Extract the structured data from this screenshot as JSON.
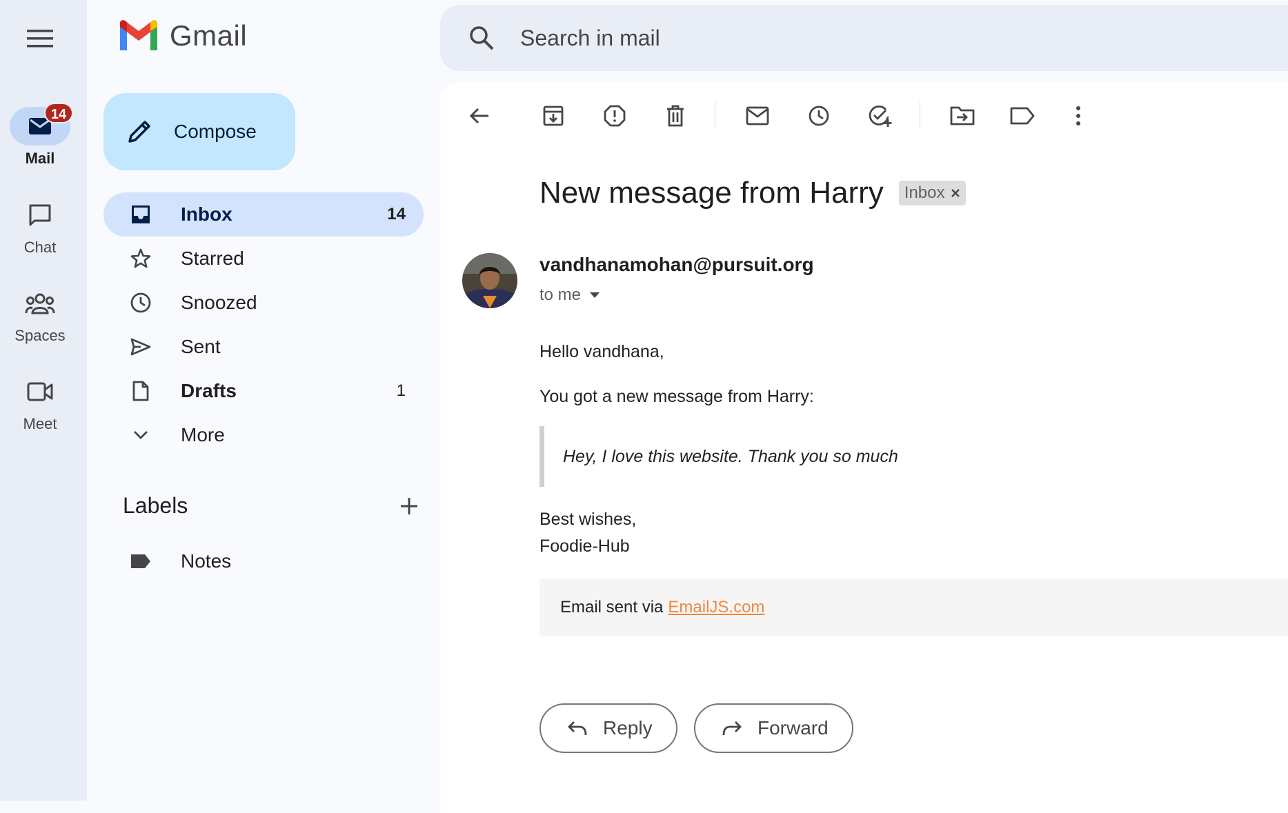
{
  "app": {
    "name": "Gmail"
  },
  "colors": {
    "accent": "#0b57d0",
    "badge": "#b3261e",
    "link": "#f0883e"
  },
  "rail": {
    "items": [
      {
        "label": "Mail",
        "icon": "mail-icon",
        "badge": "14",
        "active": true
      },
      {
        "label": "Chat",
        "icon": "chat-icon"
      },
      {
        "label": "Spaces",
        "icon": "spaces-icon"
      },
      {
        "label": "Meet",
        "icon": "meet-icon"
      }
    ]
  },
  "compose": {
    "label": "Compose"
  },
  "nav": {
    "items": [
      {
        "label": "Inbox",
        "count": "14",
        "icon": "inbox-icon"
      },
      {
        "label": "Starred",
        "icon": "star-icon"
      },
      {
        "label": "Snoozed",
        "icon": "clock-icon"
      },
      {
        "label": "Sent",
        "icon": "send-icon"
      },
      {
        "label": "Drafts",
        "count": "1",
        "icon": "draft-icon"
      },
      {
        "label": "More",
        "icon": "chevron-down-icon"
      }
    ]
  },
  "labels": {
    "title": "Labels",
    "items": [
      {
        "label": "Notes",
        "icon": "label-icon"
      }
    ]
  },
  "search": {
    "placeholder": "Search in mail"
  },
  "message": {
    "subject": "New message from Harry",
    "chip": "Inbox",
    "sender": "vandhanamohan@pursuit.org",
    "recipient": "to me",
    "greeting": "Hello vandhana,",
    "intro": "You got a new message from Harry:",
    "quote": "Hey, I love this website. Thank you so much",
    "signoff": "Best wishes,",
    "signature": "Foodie-Hub",
    "footer_text": "Email sent via",
    "footer_link": "EmailJS.com"
  },
  "actions": {
    "reply": "Reply",
    "forward": "Forward"
  }
}
